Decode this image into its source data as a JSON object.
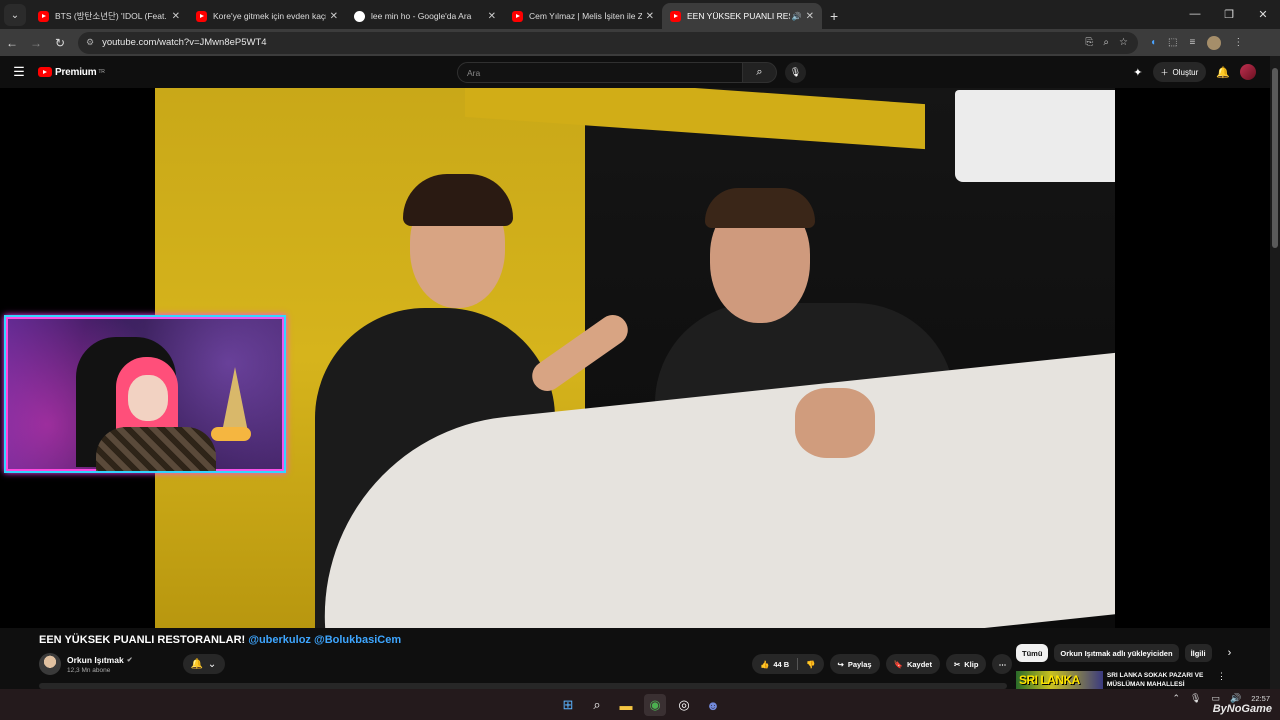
{
  "browser": {
    "tabs": [
      {
        "title": "BTS (방탄소년단) 'IDOL (Feat. N",
        "favicon": "youtube-icon",
        "active": false
      },
      {
        "title": "Kore'ye gitmek için evden kaçm",
        "favicon": "youtube-icon",
        "active": false
      },
      {
        "title": "lee min ho - Google'da Ara",
        "favicon": "google-icon",
        "active": false
      },
      {
        "title": "Cem Yılmaz | Melis İşiten ile Zar",
        "favicon": "youtube-icon",
        "active": false
      },
      {
        "title": "EEN YÜKSEK PUANLI RESTO",
        "favicon": "youtube-icon",
        "active": true
      }
    ],
    "url": "youtube.com/watch?v=JMwn8eP5WT4"
  },
  "yt_header": {
    "logo_text": "Premium",
    "logo_region": "TR",
    "search_placeholder": "Ara",
    "create_label": "Oluştur"
  },
  "video": {
    "title": "EEN YÜKSEK PUANLI RESTORANLAR!",
    "mentions": "@uberkuloz @BolukbasiCem",
    "channel_name": "Orkun Işıtmak",
    "subscribers": "12,3 Mn abone",
    "likes": "44 B",
    "share_label": "Paylaş",
    "save_label": "Kaydet",
    "clip_label": "Klip"
  },
  "sidebar_chips": {
    "items": [
      "Tümü",
      "Orkun Işıtmak adlı yükleyiciden",
      "İlgili"
    ]
  },
  "recommendation": {
    "thumb_text": "SRI LANKA",
    "title": "SRI LANKA SOKAK PAZARI VE MÜSLÜMAN MAHALLESİ"
  },
  "taskbar": {
    "time": "22:57",
    "watermark": "ByNoGame"
  },
  "colors": {
    "accent_link": "#3ea6ff",
    "youtube_red": "#ff0000",
    "webcam_border": "#33d6ff"
  }
}
